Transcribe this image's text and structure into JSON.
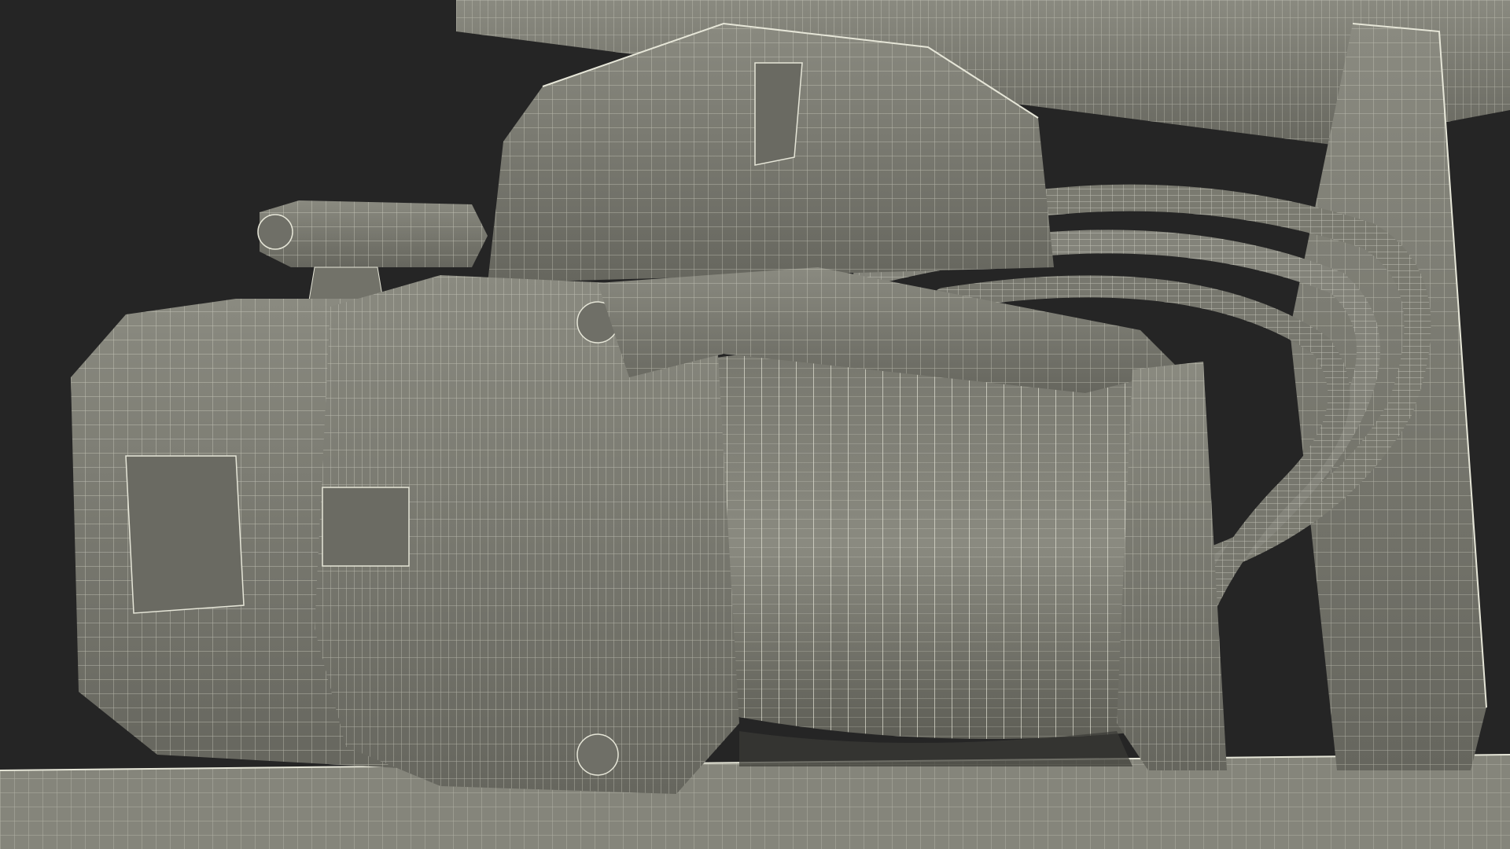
{
  "scene": {
    "subject_icon": "winch-icon",
    "render_mode": "wireframe-on-shaded",
    "colors": {
      "background": "#252525",
      "surface": "#7c7c72",
      "surface_light": "#8e8e84",
      "surface_dark": "#5f5f57",
      "wire": "#e6e6d8"
    }
  }
}
